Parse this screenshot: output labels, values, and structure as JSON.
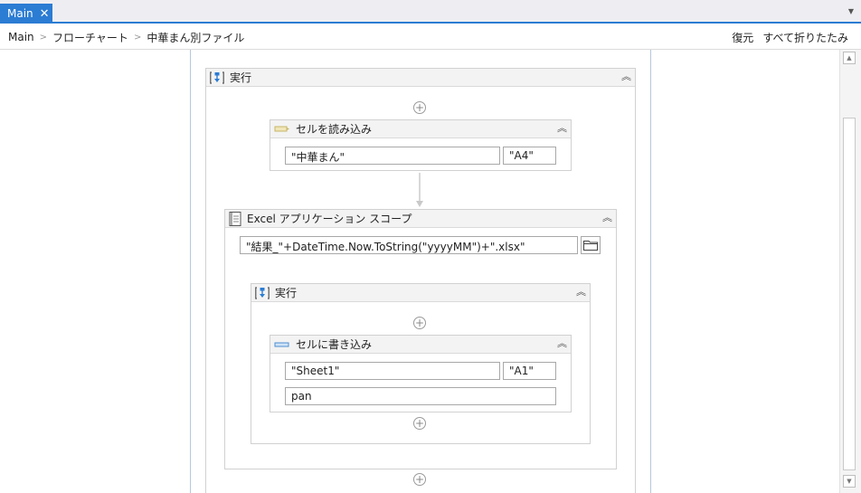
{
  "tab": {
    "label": "Main",
    "close": "✕"
  },
  "breadcrumb": {
    "items": [
      "Main",
      "フローチャート",
      "中華まん別ファイル"
    ]
  },
  "toolbar": {
    "restore_label": "復元",
    "collapse_all_label": "すべて折りたたみ"
  },
  "colors": {
    "accent": "#2b7cd3",
    "field_border": "#a8a8a8",
    "header_bg": "#f3f3f3"
  },
  "outer_sequence": {
    "title": "実行",
    "icon": "sequence-icon"
  },
  "read_cell": {
    "title": "セルを読み込み",
    "icon": "read-cell-icon",
    "cell_text": "\"中華まん\"",
    "cell_range": "\"A4\""
  },
  "excel_scope": {
    "title": "Excel アプリケーション スコープ",
    "icon": "excel-scope-icon",
    "path_value": "\"結果_\"+DateTime.Now.ToString(\"yyyyMM\")+\".xlsx\""
  },
  "inner_sequence": {
    "title": "実行",
    "icon": "sequence-icon"
  },
  "write_cell": {
    "title": "セルに書き込み",
    "icon": "write-cell-icon",
    "sheet": "\"Sheet1\"",
    "range": "\"A1\"",
    "value": "pan"
  },
  "icons": {
    "add": "⊕",
    "collapse": "︽",
    "folder": "folder-icon",
    "scroll_up": "▲",
    "scroll_down": "▼"
  }
}
